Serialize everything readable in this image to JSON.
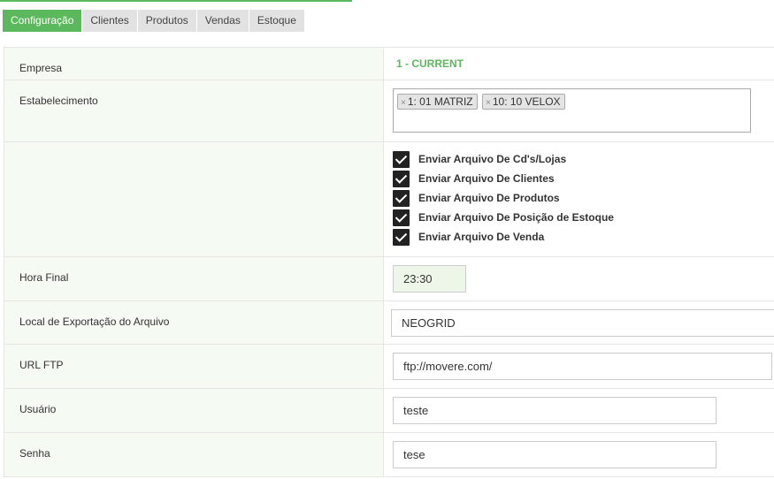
{
  "tabs": [
    "Configuração",
    "Clientes",
    "Produtos",
    "Vendas",
    "Estoque"
  ],
  "active_tab": 0,
  "form": {
    "empresa": {
      "label": "Empresa",
      "value": "1 - CURRENT"
    },
    "estabelecimento": {
      "label": "Estabelecimento",
      "tags": [
        "1: 01 MATRIZ",
        "10: 10 VELOX"
      ],
      "remove_symbol": "×"
    },
    "options": [
      {
        "label": "Enviar Arquivo De Cd's/Lojas",
        "checked": true
      },
      {
        "label": "Enviar Arquivo De Clientes",
        "checked": true
      },
      {
        "label": "Enviar Arquivo De Produtos",
        "checked": true
      },
      {
        "label": "Enviar Arquivo De Posição de Estoque",
        "checked": true
      },
      {
        "label": "Enviar Arquivo De Venda",
        "checked": true
      }
    ],
    "hora_final": {
      "label": "Hora Final",
      "value": "23:30"
    },
    "local_exportacao": {
      "label": "Local de Exportação do Arquivo",
      "value": "NEOGRID"
    },
    "url_ftp": {
      "label": "URL FTP",
      "value": "ftp://movere.com/"
    },
    "usuario": {
      "label": "Usuário",
      "value": "teste"
    },
    "senha": {
      "label": "Senha",
      "value": "tese"
    }
  },
  "colors": {
    "accent": "#5cb85c",
    "label_bg": "#f5faf3",
    "tab_bg": "#e2e2e2"
  },
  "icons": {
    "checkbox": "check-icon",
    "tag_remove": "close-icon"
  }
}
